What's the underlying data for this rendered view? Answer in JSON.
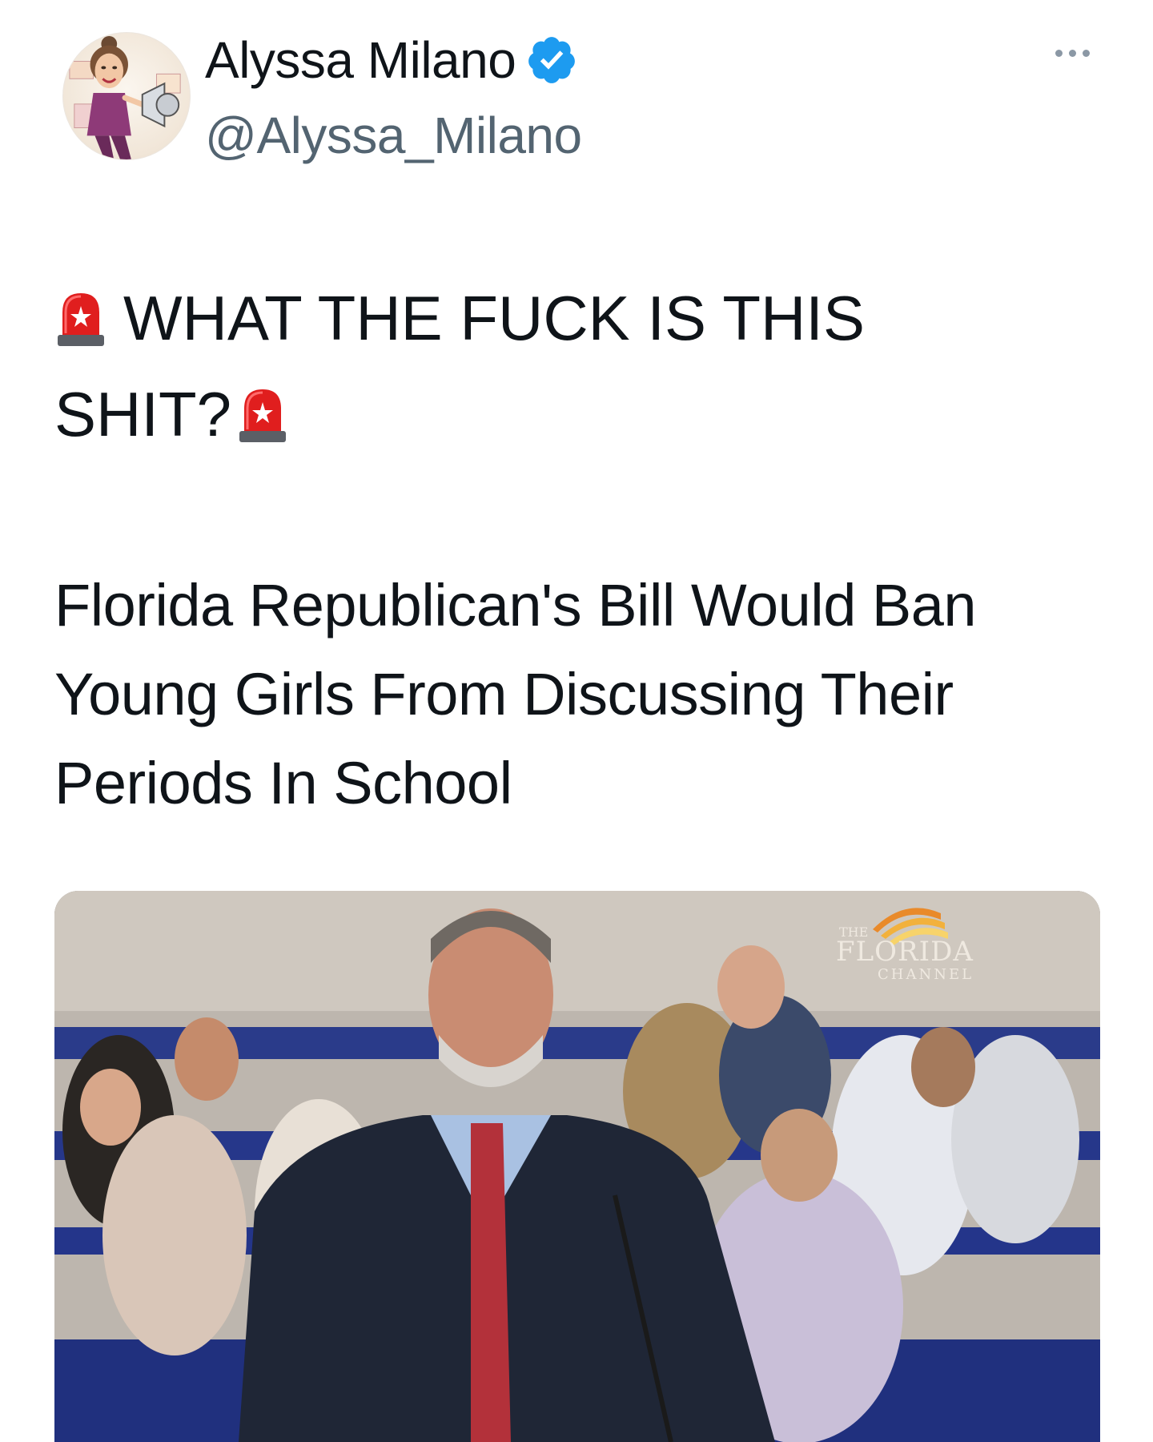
{
  "tweet": {
    "author": {
      "display_name": "Alyssa Milano",
      "handle": "@Alyssa_Milano",
      "verified": true,
      "avatar_icon": "caricature-avatar-with-megaphone"
    },
    "more_icon": "more-dots-icon",
    "text": {
      "line1": "WHAT THE FUCK IS THIS",
      "line2": "SHIT?",
      "emoji": "police-car-light"
    },
    "card": {
      "headline": "Florida Republican's Bill Would Ban Young Girls From Discussing Their Periods In School",
      "image_alt": "Man in suit speaking at a legislative hearing with audience seated behind",
      "watermark": {
        "the": "THE",
        "main": "FLORIDA",
        "sub": "CHANNEL"
      }
    }
  },
  "colors": {
    "text": "#0f1419",
    "secondary": "#536471",
    "verified": "#1d9bf0",
    "siren_red": "#e01e1e"
  }
}
